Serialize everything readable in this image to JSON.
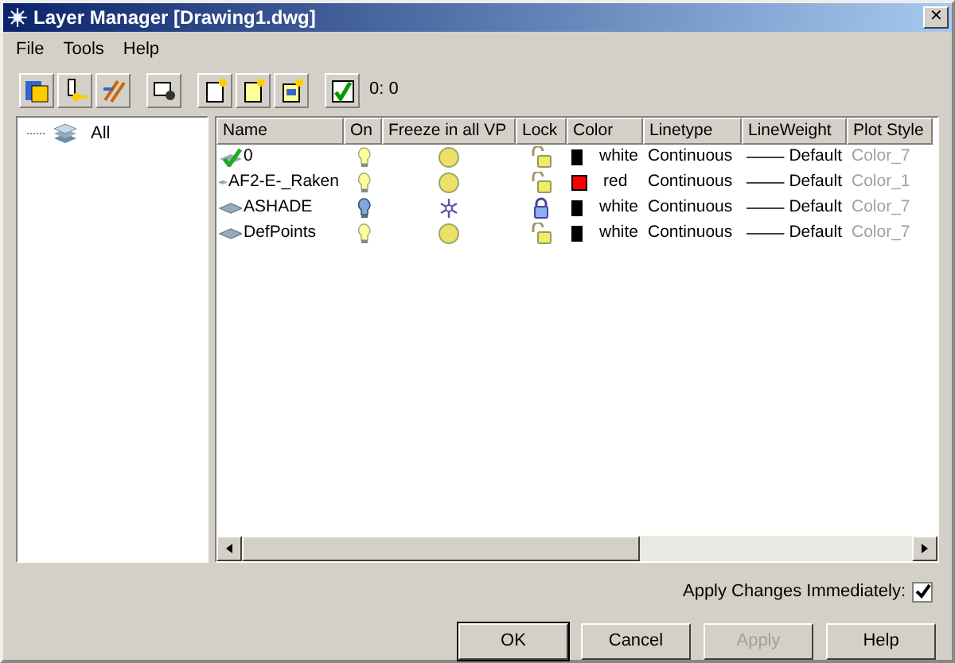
{
  "window": {
    "title": "Layer Manager [Drawing1.dwg]",
    "close": "✕"
  },
  "menu": [
    "File",
    "Tools",
    "Help"
  ],
  "toolbar": {
    "count": "0: 0"
  },
  "tree": {
    "items": [
      {
        "label": "All",
        "selected": false
      }
    ]
  },
  "table": {
    "columns": [
      "Name",
      "On",
      "Freeze in all VP",
      "Lock",
      "Color",
      "Linetype",
      "LineWeight",
      "Plot Style"
    ],
    "rows": [
      {
        "name": "0",
        "current": true,
        "on": true,
        "frozen": false,
        "locked": false,
        "color": "#000000",
        "color_name": "white",
        "linetype": "Continuous",
        "lineweight": "Default",
        "plot_style": "Color_7"
      },
      {
        "name": "AF2-E-_Raken",
        "current": false,
        "on": true,
        "frozen": false,
        "locked": false,
        "color": "#ff0000",
        "color_name": "red",
        "linetype": "Continuous",
        "lineweight": "Default",
        "plot_style": "Color_1"
      },
      {
        "name": "ASHADE",
        "current": false,
        "on": false,
        "frozen": true,
        "locked": true,
        "color": "#000000",
        "color_name": "white",
        "linetype": "Continuous",
        "lineweight": "Default",
        "plot_style": "Color_7"
      },
      {
        "name": "DefPoints",
        "current": false,
        "on": true,
        "frozen": false,
        "locked": false,
        "color": "#000000",
        "color_name": "white",
        "linetype": "Continuous",
        "lineweight": "Default",
        "plot_style": "Color_7"
      }
    ]
  },
  "apply_immediately": {
    "label": "Apply Changes Immediately:",
    "checked": true
  },
  "buttons": [
    {
      "label": "OK",
      "default": true,
      "disabled": false
    },
    {
      "label": "Cancel",
      "default": false,
      "disabled": false
    },
    {
      "label": "Apply",
      "default": false,
      "disabled": true
    },
    {
      "label": "Help",
      "default": false,
      "disabled": false
    }
  ]
}
